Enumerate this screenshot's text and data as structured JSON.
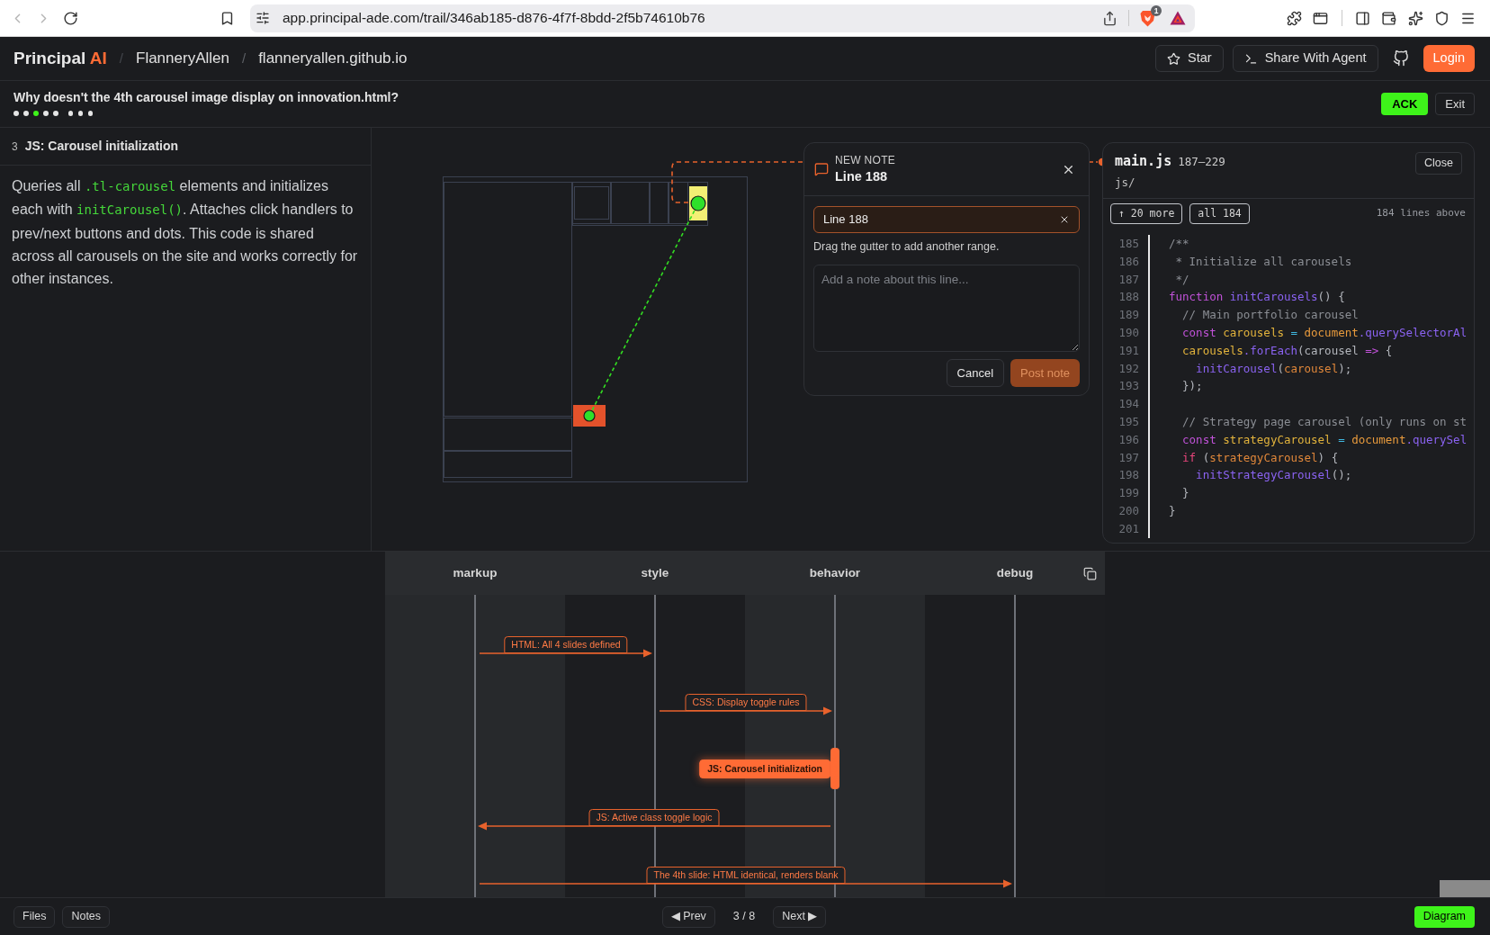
{
  "browser": {
    "url": "app.principal-ade.com/trail/346ab185-d876-4f7f-8bdd-2f5b74610b76",
    "badge": "1"
  },
  "header": {
    "logo": {
      "name": "Principal",
      "accent": "AI"
    },
    "breadcrumbs": [
      {
        "separator": "/",
        "label": "FlanneryAllen"
      },
      {
        "separator": "/",
        "label": "flanneryallen.github.io"
      }
    ],
    "actions": [
      {
        "kind": "star",
        "label": "Star"
      },
      {
        "kind": "agent",
        "label": "Share With Agent"
      },
      {
        "kind": "github"
      },
      {
        "kind": "primary",
        "label": "Login"
      }
    ]
  },
  "question": {
    "text": "Why doesn't the 4th carousel image display on innovation.html?",
    "progress_groups": [
      {
        "steps": [
          {
            "selected": false
          },
          {
            "selected": false
          },
          {
            "selected": true
          },
          {
            "selected": false
          },
          {
            "selected": false
          }
        ]
      },
      {
        "steps": [
          {
            "selected": false
          },
          {
            "selected": false
          },
          {
            "selected": false
          }
        ]
      }
    ],
    "buttons": [
      {
        "kind": "accent",
        "label": "ACK"
      },
      {
        "kind": "plain",
        "label": "Exit"
      }
    ]
  },
  "step_panel": {
    "number": "3",
    "title": "JS: Carousel initialization",
    "description": [
      {
        "kind": "text",
        "text": "Queries all "
      },
      {
        "kind": "code",
        "text": ".tl-carousel"
      },
      {
        "kind": "text",
        "text": " elements and initializes each with "
      },
      {
        "kind": "code",
        "text": "initCarousel()"
      },
      {
        "kind": "text",
        "text": ". Attaches click handlers to prev/next buttons and dots. This code is shared across all carousels on the site and works correctly for other instances."
      }
    ]
  },
  "note": {
    "eyebrow": "NEW NOTE",
    "title": "Line 188",
    "range_chip": "Line 188",
    "hint": "Drag the gutter to add another range.",
    "textarea": {
      "placeholder": "Add a note about this line..."
    },
    "buttons": [
      {
        "kind": "secondary",
        "label": "Cancel",
        "disabled": false
      },
      {
        "kind": "primary",
        "label": "Post note",
        "disabled": true
      }
    ]
  },
  "code_viewer": {
    "file": "main.js",
    "range": "187–229",
    "directory": "js/",
    "close_label": "Close",
    "expand_buttons": [
      "↑ 20 more",
      "all 184"
    ],
    "lines_above": "184 lines above",
    "lines": [
      {
        "number": "185",
        "tokens": [
          {
            "kind": "comment",
            "text": "/**"
          }
        ]
      },
      {
        "number": "186",
        "tokens": [
          {
            "kind": "comment",
            "text": " * Initialize all carousels"
          }
        ]
      },
      {
        "number": "187",
        "tokens": [
          {
            "kind": "comment",
            "text": " */"
          }
        ]
      },
      {
        "number": "188",
        "tokens": [
          {
            "kind": "keyword",
            "text": "function"
          },
          {
            "kind": "fn",
            "text": " initCarousels"
          },
          {
            "kind": "plain",
            "text": "() {"
          }
        ]
      },
      {
        "number": "189",
        "tokens": [
          {
            "kind": "comment",
            "text": "  // Main portfolio carousel"
          }
        ]
      },
      {
        "number": "190",
        "tokens": [
          {
            "kind": "keyword",
            "text": "  const"
          },
          {
            "kind": "var",
            "text": " carousels"
          },
          {
            "kind": "op",
            "text": " ="
          },
          {
            "kind": "obj",
            "text": " document"
          },
          {
            "kind": "fn",
            "text": ".querySelectorAl"
          }
        ]
      },
      {
        "number": "191",
        "tokens": [
          {
            "kind": "var",
            "text": "  carousels"
          },
          {
            "kind": "fn",
            "text": ".forEach"
          },
          {
            "kind": "plain",
            "text": "(carousel "
          },
          {
            "kind": "keyword",
            "text": "=>"
          },
          {
            "kind": "plain",
            "text": " {"
          }
        ]
      },
      {
        "number": "192",
        "tokens": [
          {
            "kind": "fn",
            "text": "    initCarousel"
          },
          {
            "kind": "plain",
            "text": "("
          },
          {
            "kind": "param",
            "text": "carousel"
          },
          {
            "kind": "plain",
            "text": ");"
          }
        ]
      },
      {
        "number": "193",
        "tokens": [
          {
            "kind": "plain",
            "text": "  });"
          }
        ]
      },
      {
        "number": "194"
      },
      {
        "number": "195",
        "tokens": [
          {
            "kind": "comment",
            "text": "  // Strategy page carousel (only runs on st"
          }
        ]
      },
      {
        "number": "196",
        "tokens": [
          {
            "kind": "keyword",
            "text": "  const"
          },
          {
            "kind": "var",
            "text": " strategyCarousel"
          },
          {
            "kind": "op",
            "text": " ="
          },
          {
            "kind": "obj",
            "text": " document"
          },
          {
            "kind": "fn",
            "text": ".querySel"
          }
        ]
      },
      {
        "number": "197",
        "tokens": [
          {
            "kind": "control",
            "text": "  if"
          },
          {
            "kind": "plain",
            "text": " ("
          },
          {
            "kind": "param",
            "text": "strategyCarousel"
          },
          {
            "kind": "plain",
            "text": ") {"
          }
        ]
      },
      {
        "number": "198",
        "tokens": [
          {
            "kind": "fn",
            "text": "    initStrategyCarousel"
          },
          {
            "kind": "plain",
            "text": "();"
          }
        ]
      },
      {
        "number": "199",
        "tokens": [
          {
            "kind": "plain",
            "text": "  }"
          }
        ]
      },
      {
        "number": "200",
        "tokens": [
          {
            "kind": "plain",
            "text": "}"
          }
        ]
      },
      {
        "number": "201"
      }
    ]
  },
  "diagram": {
    "lanes": [
      {
        "label": "markup"
      },
      {
        "label": "style"
      },
      {
        "label": "behavior"
      },
      {
        "label": "debug"
      }
    ],
    "messages": [
      {
        "kind": "message",
        "label": "HTML: All 4 slides defined",
        "selected": false
      },
      {
        "kind": "message",
        "label": "CSS: Display toggle rules",
        "selected": false
      },
      {
        "kind": "activation",
        "label": "JS: Carousel initialization",
        "selected": true
      },
      {
        "kind": "message",
        "label": "JS: Active class toggle logic",
        "selected": false
      },
      {
        "kind": "message",
        "label": "The 4th slide: HTML identical, renders blank",
        "selected": false
      }
    ]
  },
  "footer": {
    "left_buttons": [
      "Files",
      "Notes"
    ],
    "prev": "◀ Prev",
    "position": "3 / 8",
    "next": "Next ▶",
    "view_button": "Diagram"
  }
}
